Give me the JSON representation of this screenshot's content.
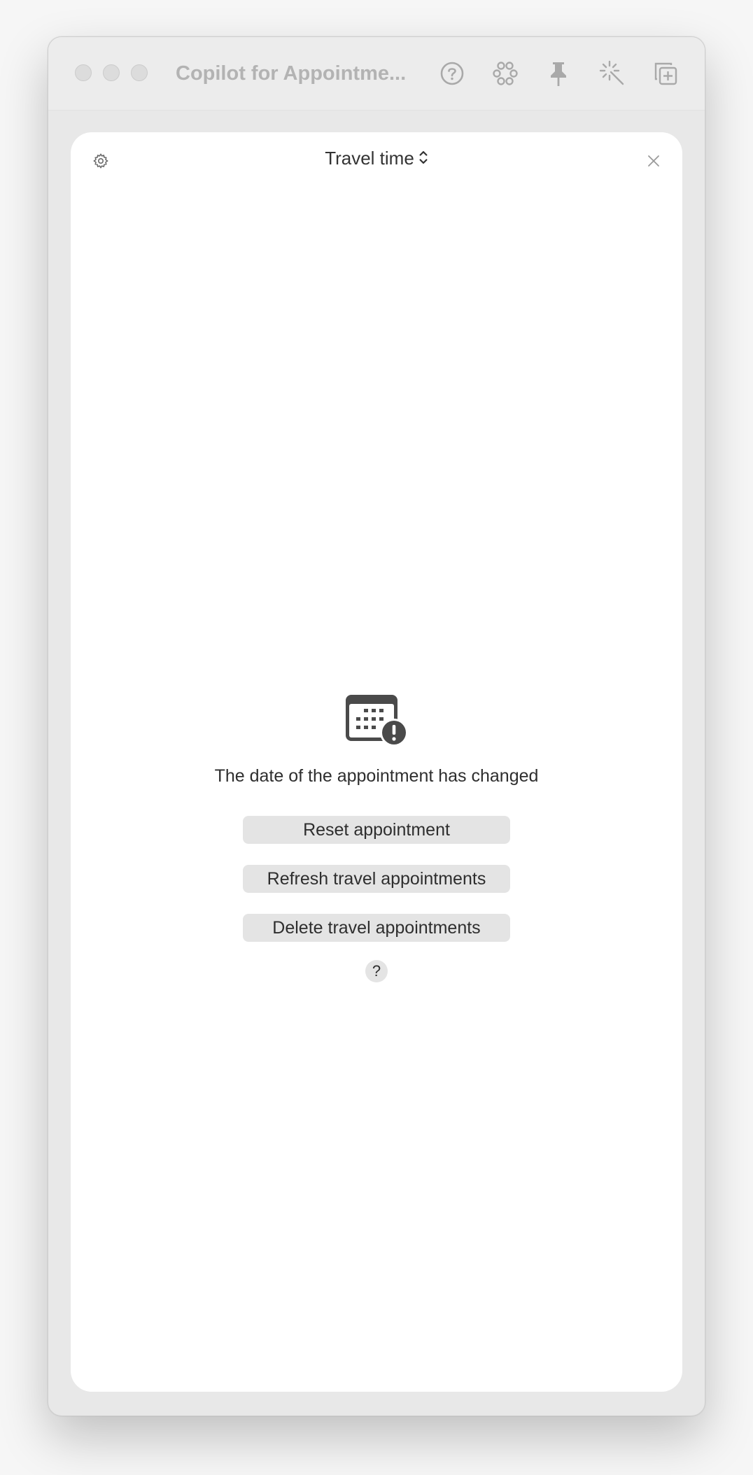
{
  "window": {
    "title": "Copilot for Appointme..."
  },
  "toolbar": {
    "icons": [
      "help-circle-icon",
      "plugins-icon",
      "pin-icon",
      "magic-wand-icon",
      "new-window-icon"
    ]
  },
  "panel": {
    "mode_label": "Travel time",
    "settings_icon": "gear-icon",
    "close_icon": "close-icon"
  },
  "status": {
    "icon": "calendar-warning-icon",
    "message": "The date of the appointment has changed"
  },
  "actions": {
    "reset_label": "Reset appointment",
    "refresh_label": "Refresh travel appointments",
    "delete_label": "Delete travel appointments",
    "help_label": "?"
  },
  "colors": {
    "window_bg": "#e8e8e8",
    "panel_bg": "#ffffff",
    "button_bg": "#e4e4e4",
    "icon_dark": "#4a4a4a",
    "muted_title": "#b3b3b3"
  }
}
